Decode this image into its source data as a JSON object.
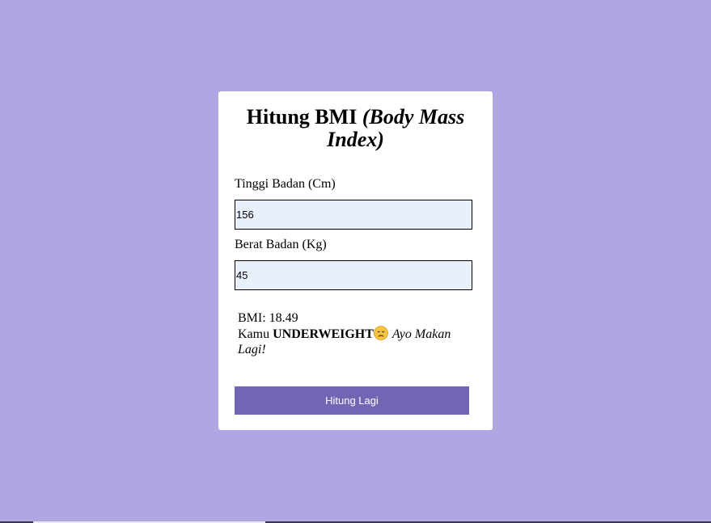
{
  "title": {
    "main": "Hitung BMI ",
    "italic": "(Body Mass Index)"
  },
  "form": {
    "height_label": "Tinggi Badan (Cm)",
    "height_value": "156",
    "weight_label": "Berat Badan (Kg)",
    "weight_value": "45"
  },
  "result": {
    "bmi_label": "BMI: ",
    "bmi_value": "18.49",
    "prefix": "Kamu ",
    "category": "UNDERWEIGHT",
    "emoji_icon": "sad-face-icon",
    "advice": "Ayo Makan Lagi!"
  },
  "button": {
    "label": "Hitung Lagi"
  },
  "colors": {
    "background": "#b0a6e2",
    "card": "#ffffff",
    "input_background": "#e8f0fe",
    "button": "#7266b4",
    "button_text": "#ffffff"
  }
}
